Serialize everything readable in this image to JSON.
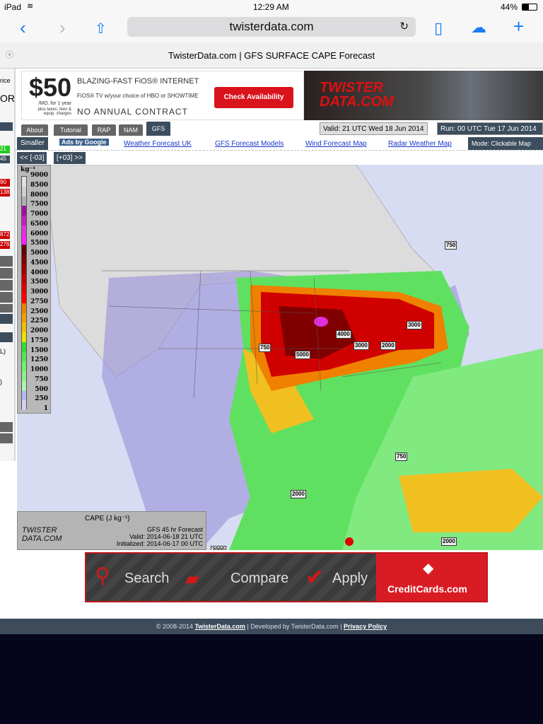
{
  "status_bar": {
    "device": "iPad",
    "time": "12:29 AM",
    "battery": "44%"
  },
  "browser": {
    "url": "twisterdata.com",
    "page_title": "TwisterData.com | GFS SURFACE CAPE Forecast"
  },
  "ad_top": {
    "left_fragment_1": "rice",
    "left_fragment_2": "OR",
    "price": "$50",
    "price_sub": "/MO. for 1 year",
    "price_fine": "plus taxes, fees & equip. charges",
    "line1": "BLAZING-FAST FiOS® INTERNET",
    "line2": "FiOS® TV w/your choice of HBO or SHOWTIME",
    "line3": "NO ANNUAL CONTRACT",
    "cta": "Check Availability"
  },
  "logo_text": "TWISTER DATA.COM",
  "tabs": [
    {
      "label": "About"
    },
    {
      "label": "Tutorial"
    },
    {
      "label": "RAP"
    },
    {
      "label": "NAM"
    },
    {
      "label": "GFS",
      "active": true
    }
  ],
  "valid": "Valid: 21 UTC Wed 18 Jun 2014",
  "run": "Run: 00 UTC Tue 17 Jun 2014",
  "links": {
    "smaller": "Smaller",
    "ads_by_google": "Ads by Google",
    "items": [
      "Weather Forecast UK",
      "GFS Forecast Models",
      "Wind Forecast Map",
      "Radar Weather Map"
    ],
    "mode": "Mode: Clickable Map"
  },
  "nav": {
    "prev": "<< [-03]",
    "next": "[+03] >>"
  },
  "sidebar": {
    "badges": [
      "21",
      "45",
      "90",
      "138",
      "276",
      "872"
    ],
    "fragments": [
      "L)",
      ")"
    ]
  },
  "legend": {
    "unit": "kg⁻¹",
    "ticks": [
      "9000",
      "8500",
      "8000",
      "7500",
      "7000",
      "6500",
      "6000",
      "5500",
      "5000",
      "4500",
      "4000",
      "3500",
      "3000",
      "2750",
      "2500",
      "2250",
      "2000",
      "1750",
      "1500",
      "1250",
      "1000",
      "750",
      "500",
      "250",
      "1"
    ],
    "colors": [
      "#e0e0e0",
      "#d0d0d0",
      "#b0b0b0",
      "#a010a0",
      "#c020c0",
      "#e030e0",
      "#ff20ff",
      "#600000",
      "#800000",
      "#a00000",
      "#c00000",
      "#e00000",
      "#ff0000",
      "#f08000",
      "#f0a000",
      "#f0c000",
      "#f0e000",
      "#30e030",
      "#50e850",
      "#70f070",
      "#90f090",
      "#b0f4b0",
      "#b8b8f0",
      "#d0d0f4",
      "#ececfa"
    ]
  },
  "map_labels": [
    "750",
    "5000",
    "4000",
    "3000",
    "2000",
    "3000",
    "750",
    "750",
    "2000",
    "2000",
    "2000"
  ],
  "caption": {
    "title": "CAPE (J kg⁻¹)",
    "logo": "TWISTER DATA.COM",
    "forecast": "GFS 45 hr Forecast",
    "valid": "Valid: 2014-06-18 21 UTC",
    "initialized": "Initialized: 2014-06-17 00 UTC"
  },
  "ad_bottom": {
    "search": "Search",
    "compare": "Compare",
    "apply": "Apply",
    "brand": "CreditCards.com"
  },
  "footer": {
    "copyright": "© 2008-2014",
    "site_link": "TwisterData.com",
    "developed": "| Developed by TwisterData.com |",
    "privacy": "Privacy Policy"
  }
}
